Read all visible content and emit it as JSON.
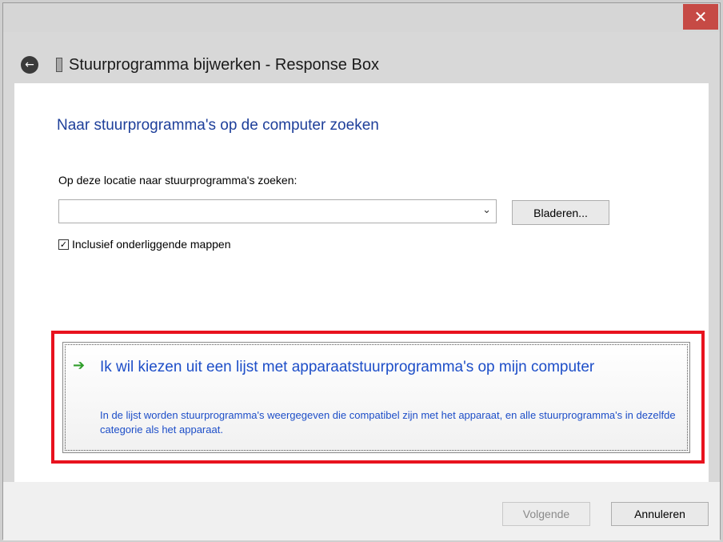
{
  "window": {
    "title": "Stuurprogramma bijwerken - Response Box",
    "close_glyph": "✕",
    "back_glyph": "←"
  },
  "main": {
    "heading": "Naar stuurprogramma's op de computer zoeken",
    "location_label": "Op deze locatie naar stuurprogramma's zoeken:",
    "location_value": "",
    "combo_arrow": "⌄",
    "browse_label": "Bladeren...",
    "include_subfolders": {
      "checked": true,
      "mark": "✓",
      "label": "Inclusief onderliggende mappen"
    }
  },
  "choice": {
    "arrow": "➔",
    "title": "Ik wil kiezen uit een lijst met apparaatstuurprogramma's op mijn computer",
    "description": "In de lijst worden stuurprogramma's weergegeven die compatibel zijn met het apparaat, en alle stuurprogramma's in dezelfde categorie als het apparaat.",
    "highlight_color": "#e8121e"
  },
  "footer": {
    "next_label": "Volgende",
    "next_disabled": true,
    "cancel_label": "Annuleren"
  },
  "colors": {
    "heading": "#1e3f9a",
    "link": "#1d4ec8",
    "close": "#c64a45"
  }
}
